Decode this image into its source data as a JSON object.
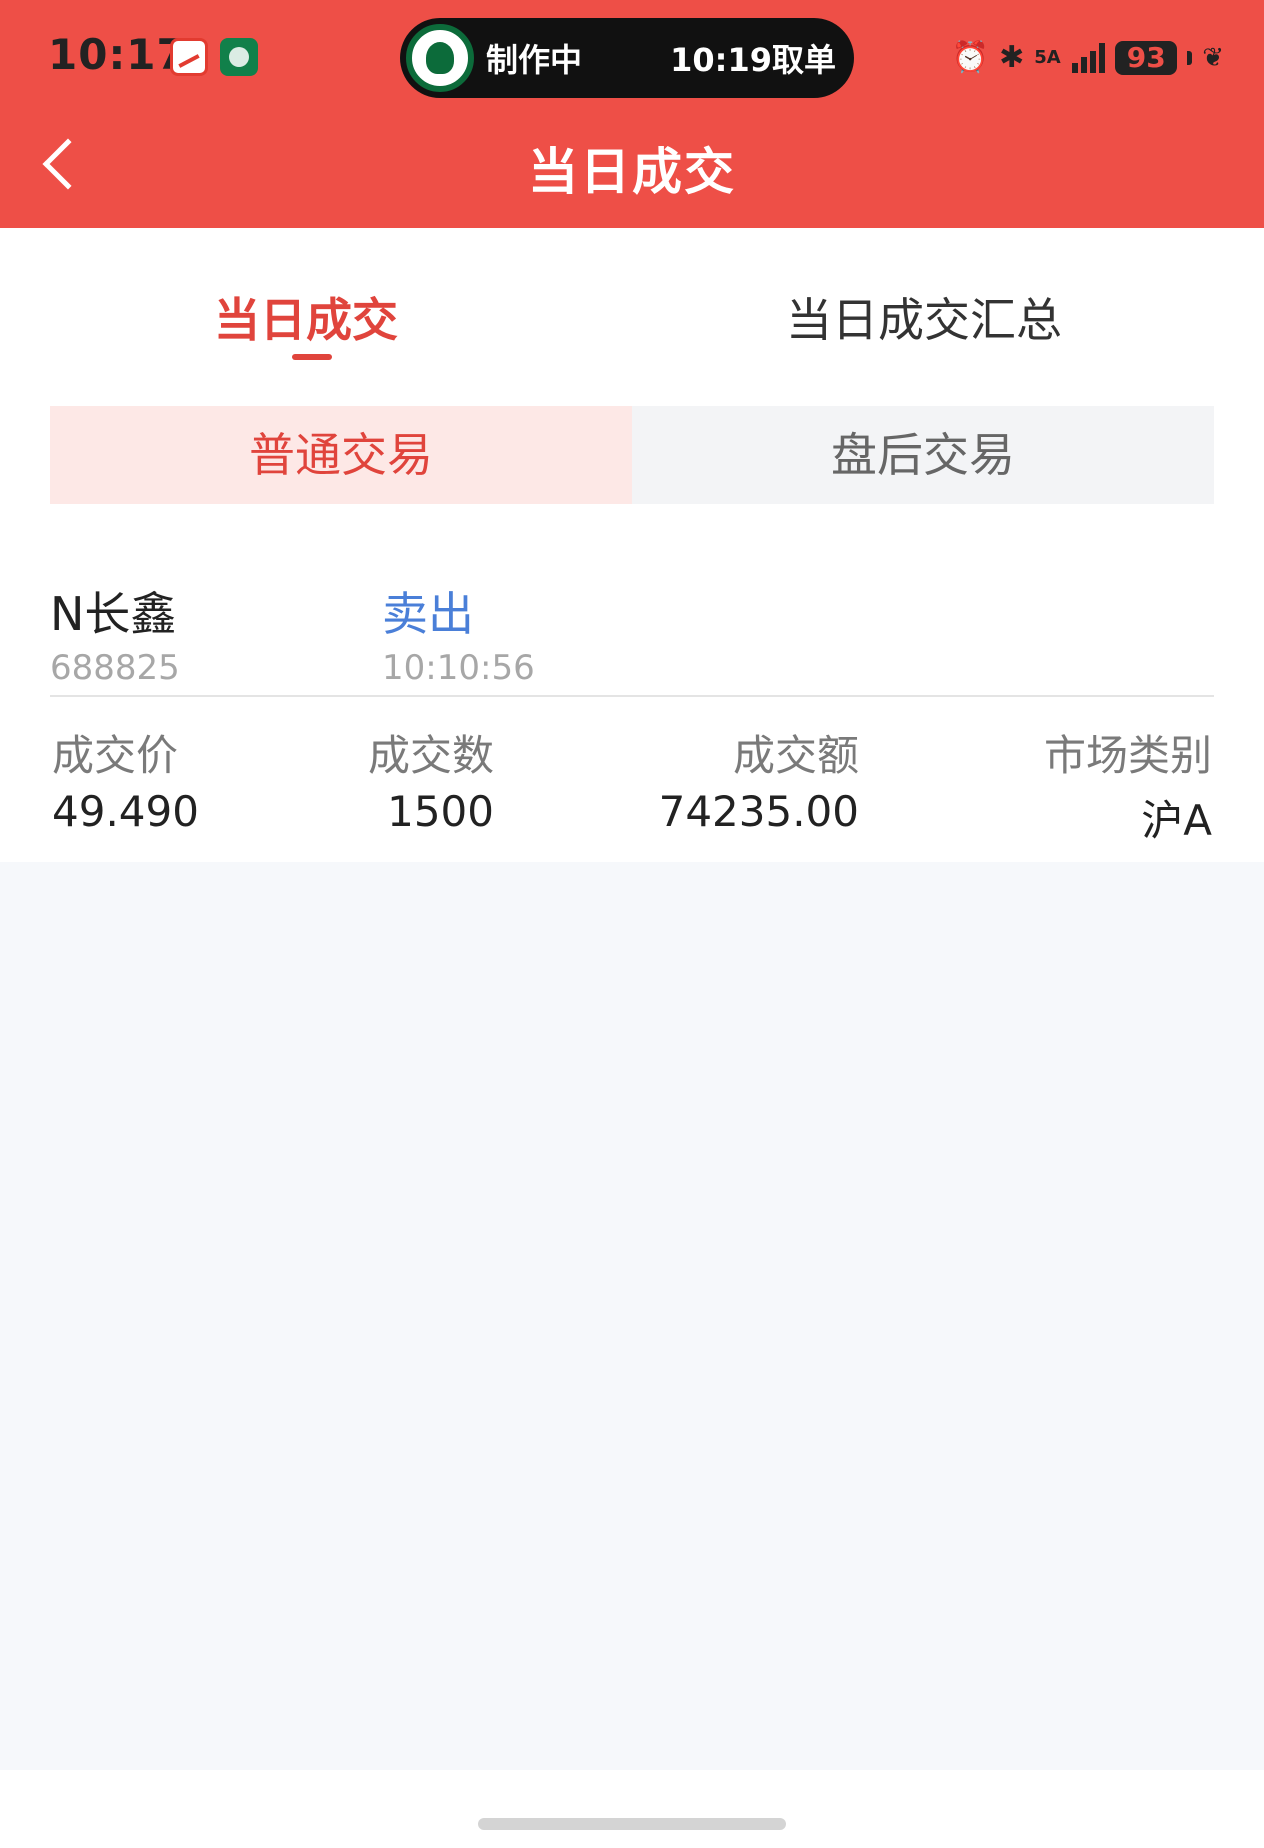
{
  "status_bar": {
    "time": "10:17",
    "live_activity": {
      "status": "制作中",
      "eta": "10:19取单"
    },
    "network": "5A",
    "battery": "93"
  },
  "nav": {
    "title": "当日成交"
  },
  "tabs": [
    {
      "label": "当日成交",
      "active": true
    },
    {
      "label": "当日成交汇总",
      "active": false
    }
  ],
  "segments": [
    {
      "label": "普通交易",
      "active": true
    },
    {
      "label": "盘后交易",
      "active": false
    }
  ],
  "trade": {
    "name": "N长鑫",
    "code": "688825",
    "direction": "卖出",
    "time": "10:10:56",
    "fields": [
      {
        "label": "成交价",
        "value": "49.490"
      },
      {
        "label": "成交数",
        "value": "1500"
      },
      {
        "label": "成交额",
        "value": "74235.00"
      },
      {
        "label": "市场类别",
        "value": "沪A"
      }
    ]
  },
  "colors": {
    "header": "#ee4f47",
    "accent": "#e0443c",
    "sell": "#4a7fd8",
    "background": "#f6f8fb"
  },
  "icons": [
    "back-chevron-icon",
    "alarm-icon",
    "bluetooth-icon",
    "signal-icon",
    "battery-icon",
    "leaf-icon",
    "stock-app-icon",
    "coffee-app-icon"
  ]
}
